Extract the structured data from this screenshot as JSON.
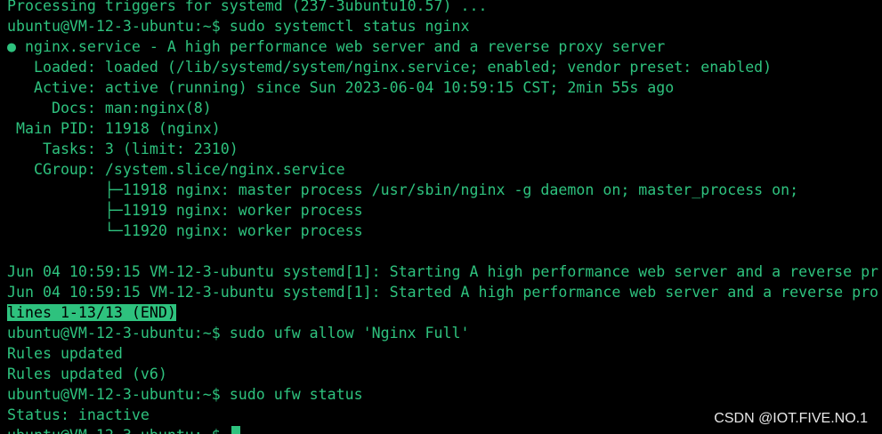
{
  "terminal": {
    "text_color": "#2ec27e",
    "background": "#000000",
    "lines": [
      "Processing triggers for systemd (237-3ubuntu10.57) ...",
      "ubuntu@VM-12-3-ubuntu:~$ sudo systemctl status nginx",
      "● nginx.service - A high performance web server and a reverse proxy server",
      "   Loaded: loaded (/lib/systemd/system/nginx.service; enabled; vendor preset: enabled)",
      "   Active: active (running) since Sun 2023-06-04 10:59:15 CST; 2min 55s ago",
      "     Docs: man:nginx(8)",
      " Main PID: 11918 (nginx)",
      "    Tasks: 3 (limit: 2310)",
      "   CGroup: /system.slice/nginx.service",
      "           ├─11918 nginx: master process /usr/sbin/nginx -g daemon on; master_process on;",
      "           ├─11919 nginx: worker process",
      "           └─11920 nginx: worker process",
      "",
      "Jun 04 10:59:15 VM-12-3-ubuntu systemd[1]: Starting A high performance web server and a reverse pr",
      "Jun 04 10:59:15 VM-12-3-ubuntu systemd[1]: Started A high performance web server and a reverse pro",
      "lines 1-13/13 (END)",
      "ubuntu@VM-12-3-ubuntu:~$ sudo ufw allow 'Nginx Full'",
      "Rules updated",
      "Rules updated (v6)",
      "ubuntu@VM-12-3-ubuntu:~$ sudo ufw status",
      "Status: inactive",
      "ubuntu@VM-12-3-ubuntu:~$ "
    ]
  },
  "watermark": "CSDN @IOT.FIVE.NO.1"
}
